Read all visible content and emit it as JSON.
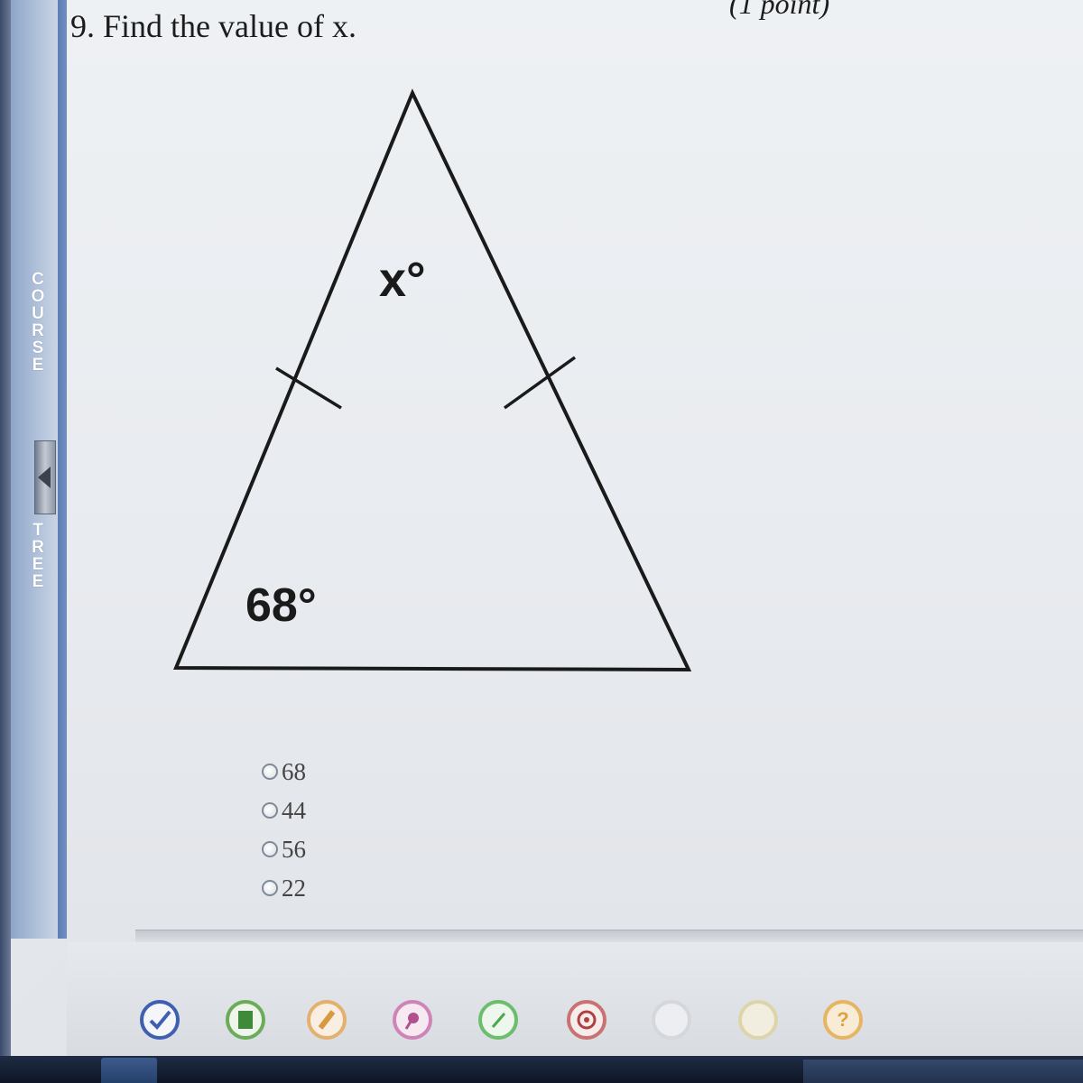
{
  "question": {
    "text": "9. Find the value of x.",
    "points": "(1 point)"
  },
  "sidebar": {
    "course_letters": [
      "C",
      "O",
      "U",
      "R",
      "S",
      "E"
    ],
    "tree_letters": [
      "T",
      "R",
      "E",
      "E"
    ]
  },
  "diagram": {
    "apex_label": "x°",
    "base_angle_label": "68°"
  },
  "choices": [
    {
      "label": "68",
      "selected": false
    },
    {
      "label": "44",
      "selected": false
    },
    {
      "label": "56",
      "selected": false
    },
    {
      "label": "22",
      "selected": false
    }
  ],
  "toolbar": {
    "tools": [
      {
        "name": "check-tool",
        "color": "#3f5fb0"
      },
      {
        "name": "notebook-tool",
        "color": "#3e8a3a"
      },
      {
        "name": "highlighter-tool",
        "color": "#d89a40"
      },
      {
        "name": "pin-tool",
        "color": "#b0508e"
      },
      {
        "name": "pencil-tool",
        "color": "#4aa84a"
      },
      {
        "name": "target-tool",
        "color": "#b04040"
      },
      {
        "name": "blank-tool",
        "color": "#c9ccd2"
      },
      {
        "name": "tool-eight",
        "color": "#d0c79a"
      },
      {
        "name": "help-tool",
        "color": "#e0a040",
        "glyph": "?"
      }
    ]
  }
}
